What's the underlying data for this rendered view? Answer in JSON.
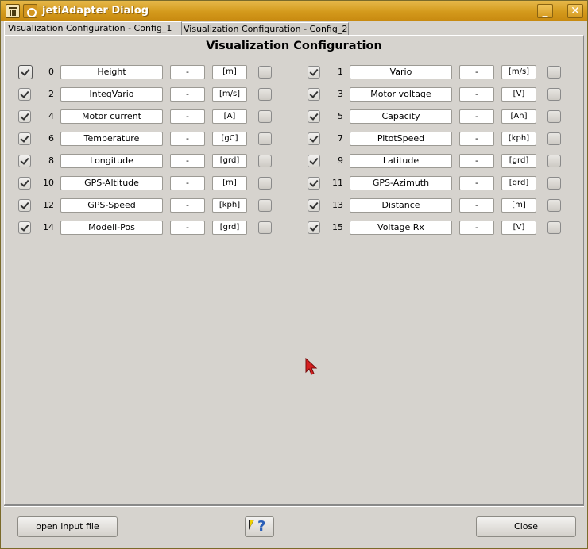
{
  "window": {
    "title": "jetiAdapter Dialog",
    "minimize_label": "_",
    "close_label": "✕"
  },
  "tabs": [
    {
      "label": "Visualization Configuration - Config_1",
      "active": true
    },
    {
      "label": "Visualization Configuration - Config_2",
      "active": false
    }
  ],
  "panel": {
    "title": "Visualization Configuration"
  },
  "rows_left": [
    {
      "index": "0",
      "name": "Height",
      "factor": "-",
      "unit": "[m]",
      "enabled": true
    },
    {
      "index": "2",
      "name": "IntegVario",
      "factor": "-",
      "unit": "[m/s]",
      "enabled": true
    },
    {
      "index": "4",
      "name": "Motor current",
      "factor": "-",
      "unit": "[A]",
      "enabled": true
    },
    {
      "index": "6",
      "name": "Temperature",
      "factor": "-",
      "unit": "[gC]",
      "enabled": true
    },
    {
      "index": "8",
      "name": "Longitude",
      "factor": "-",
      "unit": "[grd]",
      "enabled": true
    },
    {
      "index": "10",
      "name": "GPS-Altitude",
      "factor": "-",
      "unit": "[m]",
      "enabled": true
    },
    {
      "index": "12",
      "name": "GPS-Speed",
      "factor": "-",
      "unit": "[kph]",
      "enabled": true
    },
    {
      "index": "14",
      "name": "Modell-Pos",
      "factor": "-",
      "unit": "[grd]",
      "enabled": true
    }
  ],
  "rows_right": [
    {
      "index": "1",
      "name": "Vario",
      "factor": "-",
      "unit": "[m/s]",
      "enabled": true
    },
    {
      "index": "3",
      "name": "Motor voltage",
      "factor": "-",
      "unit": "[V]",
      "enabled": true
    },
    {
      "index": "5",
      "name": "Capacity",
      "factor": "-",
      "unit": "[Ah]",
      "enabled": true
    },
    {
      "index": "7",
      "name": "PitotSpeed",
      "factor": "-",
      "unit": "[kph]",
      "enabled": true
    },
    {
      "index": "9",
      "name": "Latitude",
      "factor": "-",
      "unit": "[grd]",
      "enabled": true
    },
    {
      "index": "11",
      "name": "GPS-Azimuth",
      "factor": "-",
      "unit": "[grd]",
      "enabled": true
    },
    {
      "index": "13",
      "name": "Distance",
      "factor": "-",
      "unit": "[m]",
      "enabled": true
    },
    {
      "index": "15",
      "name": "Voltage Rx",
      "factor": "-",
      "unit": "[V]",
      "enabled": true
    }
  ],
  "footer": {
    "open_label": "open input file",
    "help_label": "?",
    "close_label": "Close"
  }
}
